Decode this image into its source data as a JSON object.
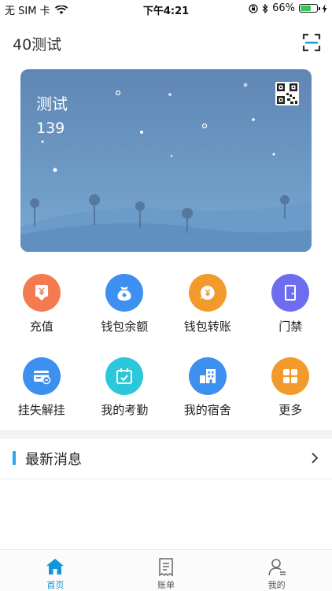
{
  "status_bar": {
    "carrier": "无 SIM 卡",
    "time": "下午4:21",
    "battery": "66%",
    "battery_level": 0.66,
    "icons": [
      "wifi-icon",
      "orientation-lock-icon",
      "bluetooth-icon",
      "battery-icon",
      "charging-icon"
    ]
  },
  "header": {
    "title": "40测试",
    "scan_icon": "scan-icon"
  },
  "card": {
    "name": "测试",
    "number": "139",
    "qr_icon": "qr-code-icon"
  },
  "grid": {
    "row1": [
      {
        "label": "充值",
        "icon": "recharge-icon",
        "color": "#f47a4f"
      },
      {
        "label": "钱包余额",
        "icon": "wallet-balance-icon",
        "color": "#3d8ff0"
      },
      {
        "label": "钱包转账",
        "icon": "wallet-transfer-icon",
        "color": "#f39a2c"
      },
      {
        "label": "门禁",
        "icon": "door-access-icon",
        "color": "#6e6df0"
      }
    ],
    "row2": [
      {
        "label": "挂失解挂",
        "icon": "card-lost-icon",
        "color": "#3d8ff0"
      },
      {
        "label": "我的考勤",
        "icon": "attendance-calendar-icon",
        "color": "#2cc7da"
      },
      {
        "label": "我的宿舍",
        "icon": "dormitory-building-icon",
        "color": "#3d8ff0"
      },
      {
        "label": "更多",
        "icon": "more-grid-icon",
        "color": "#f39a2c"
      }
    ]
  },
  "news": {
    "title": "最新消息",
    "accent": "#2aa6f0"
  },
  "tabbar": {
    "tabs": [
      {
        "label": "首页",
        "icon": "home-icon",
        "active": true
      },
      {
        "label": "账单",
        "icon": "bill-icon",
        "active": false
      },
      {
        "label": "我的",
        "icon": "profile-icon",
        "active": false
      }
    ],
    "active_color": "#1296db"
  }
}
